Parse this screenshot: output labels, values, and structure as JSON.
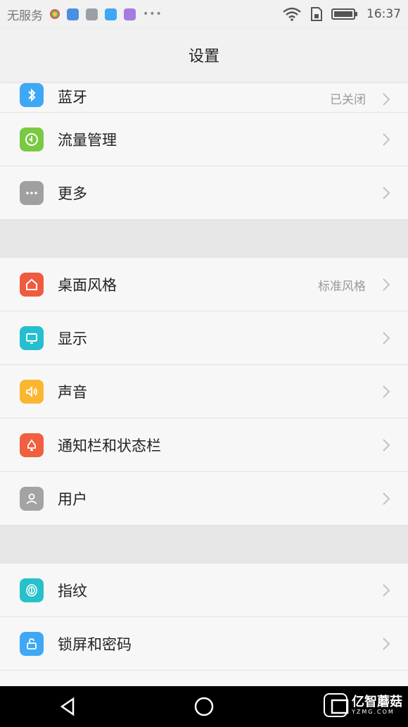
{
  "status": {
    "carrier": "无服务",
    "time": "16:37",
    "notif_colors": [
      "#4a90e2",
      "#9aa0a6",
      "#3fa7f5",
      "#a57be0"
    ]
  },
  "header": {
    "title": "设置"
  },
  "sections": {
    "top": [
      {
        "id": "bluetooth",
        "label": "蓝牙",
        "value": "已关闭",
        "color": "#3fa8f5",
        "icon": "bluetooth-icon"
      },
      {
        "id": "traffic",
        "label": "流量管理",
        "value": "",
        "color": "#7ac943",
        "icon": "data-usage-icon"
      },
      {
        "id": "more",
        "label": "更多",
        "value": "",
        "color": "#a0a0a0",
        "icon": "more-icon"
      }
    ],
    "display": [
      {
        "id": "home-style",
        "label": "桌面风格",
        "value": "标准风格",
        "color": "#f05b40",
        "icon": "home-icon"
      },
      {
        "id": "display",
        "label": "显示",
        "value": "",
        "color": "#26bfcf",
        "icon": "display-icon"
      },
      {
        "id": "sound",
        "label": "声音",
        "value": "",
        "color": "#fbb630",
        "icon": "sound-icon"
      },
      {
        "id": "notify",
        "label": "通知栏和状态栏",
        "value": "",
        "color": "#f06040",
        "icon": "notification-icon"
      },
      {
        "id": "users",
        "label": "用户",
        "value": "",
        "color": "#a3a3a3",
        "icon": "user-icon"
      }
    ],
    "security": [
      {
        "id": "fingerprint",
        "label": "指纹",
        "value": "",
        "color": "#26c1c9",
        "icon": "fingerprint-icon"
      },
      {
        "id": "lock",
        "label": "锁屏和密码",
        "value": "",
        "color": "#3fa8f5",
        "icon": "lock-icon"
      }
    ]
  },
  "watermark": {
    "title": "亿智蘑菇",
    "sub": "YZMG.COM"
  }
}
